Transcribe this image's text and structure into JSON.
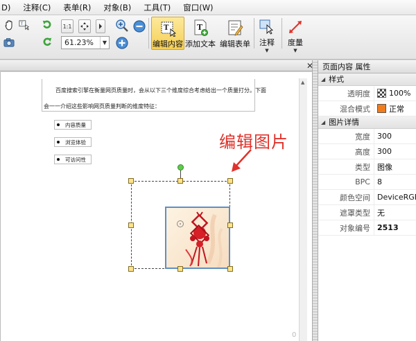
{
  "menu": {
    "items": [
      "D)",
      "注释(C)",
      "表单(R)",
      "对象(B)",
      "工具(T)",
      "窗口(W)"
    ]
  },
  "toolbar": {
    "zoom_value": "61.23%",
    "buttons": {
      "edit_content": "编辑内容",
      "add_text": "添加文本",
      "edit_form": "编辑表单",
      "annotate": "注释",
      "measure": "度量"
    },
    "small_labels": {
      "actual_size": "1:1"
    }
  },
  "document": {
    "paragraph_line1": "百度搜索引擎在衡量网页质量时，会从以下三个维度综合考虑给出一个质量打分。下面",
    "paragraph_line2": "会一一介绍这些影响网页质量判断的维度特征：",
    "bullets": [
      "内容质量",
      "浏览体验",
      "可访问性"
    ],
    "annotation_text": "编辑图片",
    "page_number_partial": "0"
  },
  "panel": {
    "title": "页面内容 属性",
    "style_section": "样式",
    "opacity_label": "透明度",
    "opacity_value": "100%",
    "blend_label": "混合模式",
    "blend_value": "正常",
    "image_section": "图片详情",
    "width_label": "宽度",
    "width_value": "300",
    "height_label": "高度",
    "height_value": "300",
    "type_label": "类型",
    "type_value": "图像",
    "bpc_label": "BPC",
    "bpc_value": "8",
    "colorspace_label": "颜色空间",
    "colorspace_value": "DeviceRGB",
    "mask_label": "遮罩类型",
    "mask_value": "无",
    "objnum_label": "对象编号",
    "objnum_value": "2513"
  },
  "colors": {
    "active_button": "#f5cf55",
    "annotation_red": "#e0322b",
    "selection_handle": "#fde38b",
    "rotate_handle": "#5dcc4b",
    "blend_swatch": "#f07c1c"
  },
  "icons": [
    "hand-icon",
    "select-text-icon",
    "snapshot-icon",
    "rotate-cw-icon",
    "rotate-ccw-icon",
    "fit-page-icon",
    "fit-width-icon",
    "zoom-in-icon",
    "zoom-out-icon",
    "zoom-add-icon",
    "edit-content-icon",
    "add-text-icon",
    "edit-form-icon",
    "annotate-icon",
    "measure-icon",
    "close-icon"
  ]
}
